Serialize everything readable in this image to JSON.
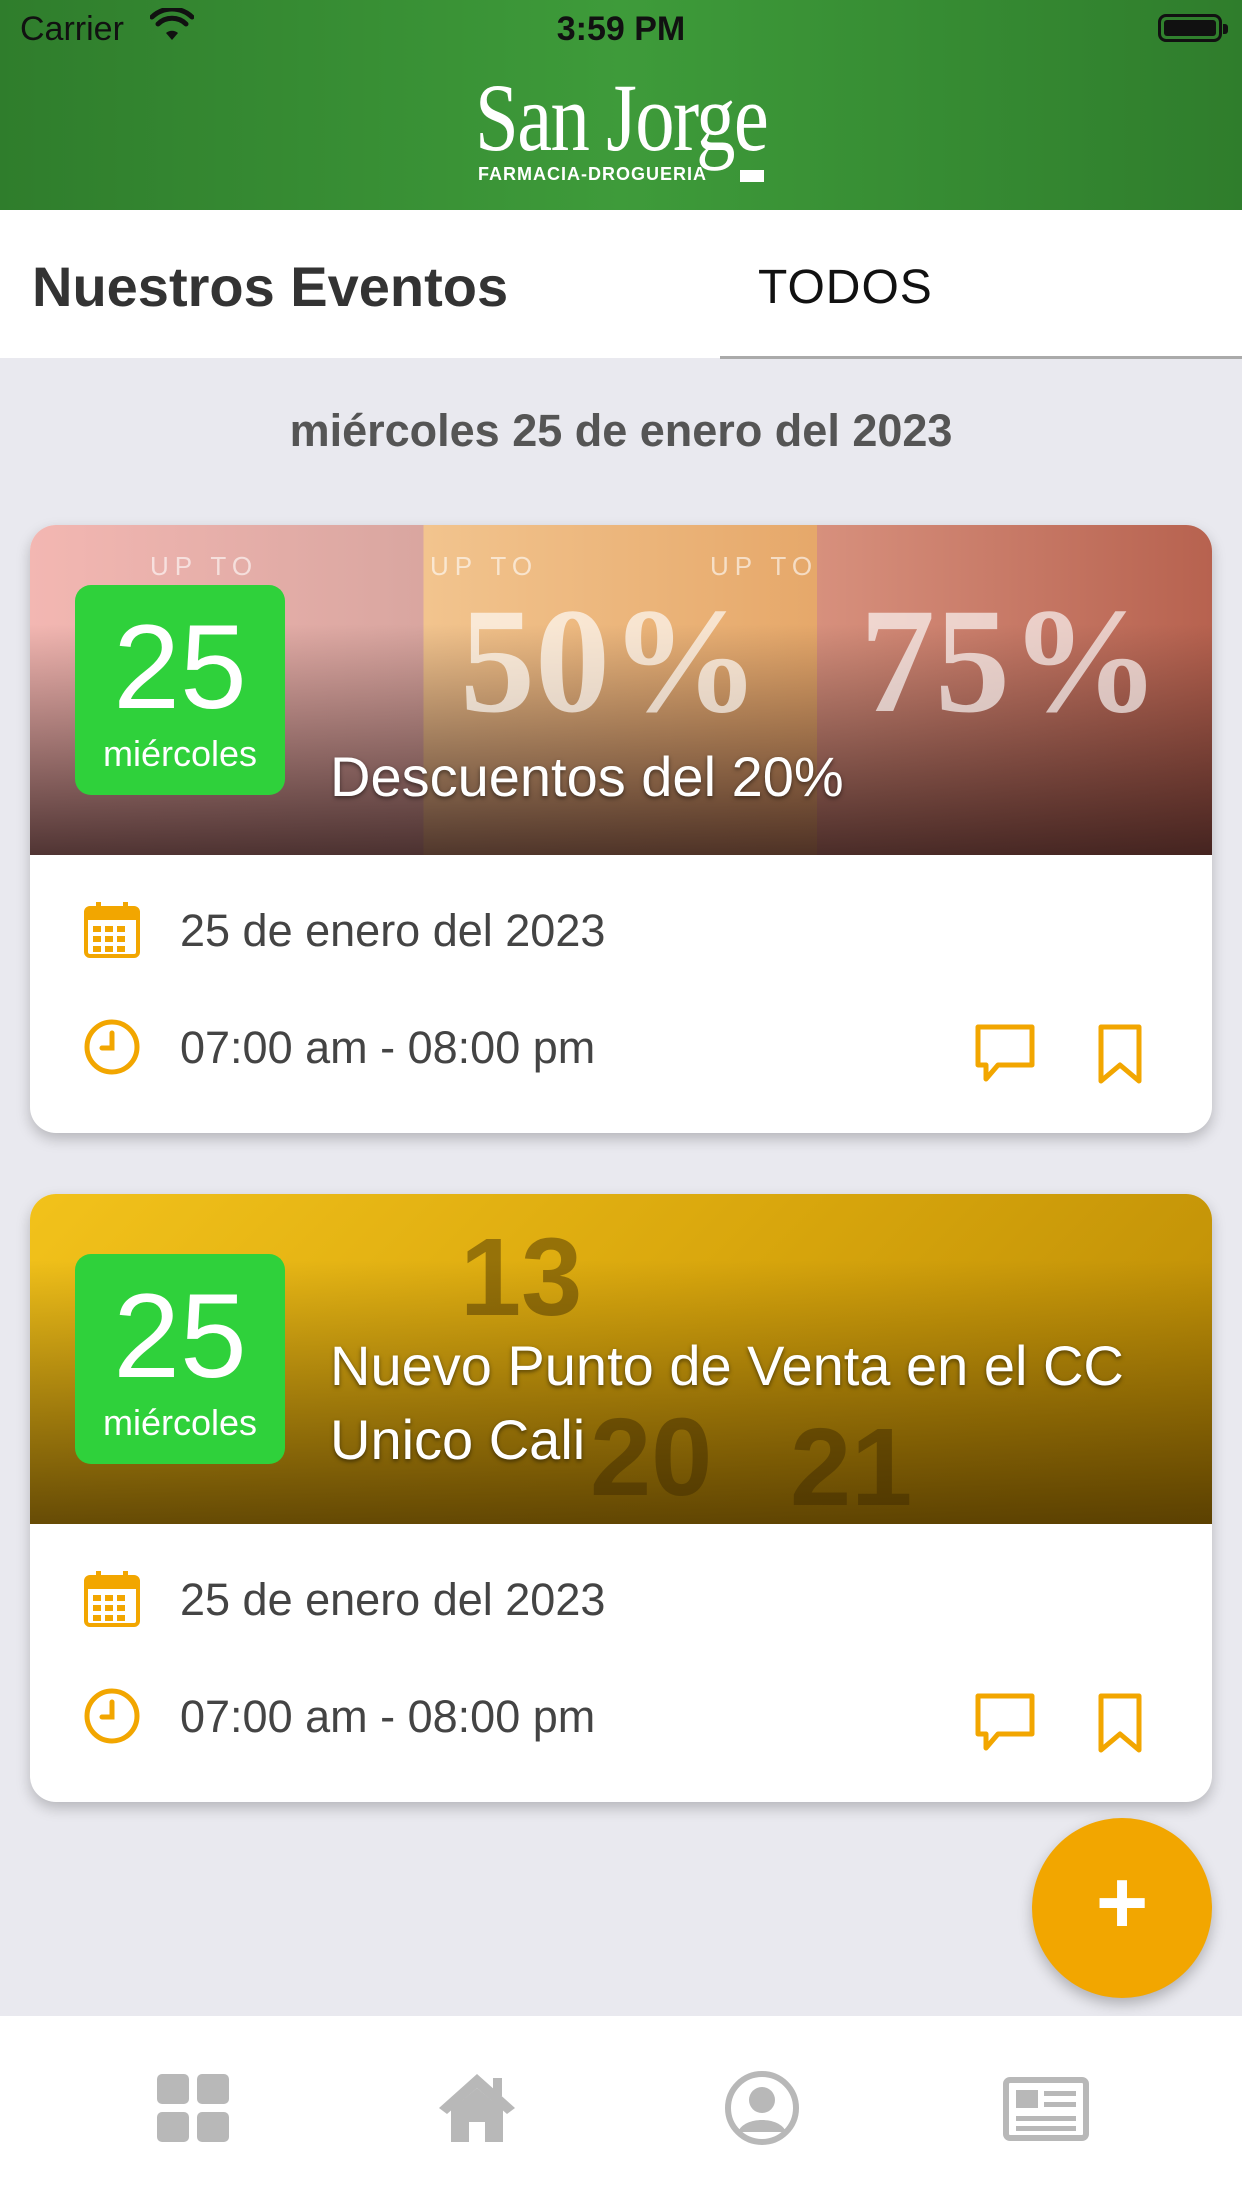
{
  "status_bar": {
    "carrier": "Carrier",
    "time": "3:59 PM"
  },
  "header": {
    "brand": "San Jorge",
    "subtitle": "FARMACIA-DROGUERIA"
  },
  "section": {
    "title": "Nuestros Eventos",
    "tab_label": "TODOS"
  },
  "date_heading": "miércoles 25 de enero del 2023",
  "events": [
    {
      "day": "25",
      "weekday": "miércoles",
      "title": "Descuentos del 20%",
      "date": "25 de enero del 2023",
      "time": "07:00 am - 08:00 pm",
      "banner_text": [
        "UP TO",
        "50%",
        "UP TO",
        "75%"
      ]
    },
    {
      "day": "25",
      "weekday": "miércoles",
      "title": "Nuevo Punto de Venta en el CC Unico Cali",
      "date": "25 de enero del 2023",
      "time": "07:00 am - 08:00 pm"
    }
  ],
  "fab": {
    "label": "+"
  },
  "colors": {
    "header_green": "#3e9b3a",
    "accent_orange": "#f2a600",
    "badge_green": "#2fd13b"
  },
  "icons": {
    "card_rows": [
      "calendar-icon",
      "clock-icon"
    ],
    "card_actions": [
      "comment-icon",
      "bookmark-icon"
    ],
    "bottom_nav": [
      "grid-icon",
      "home-icon",
      "user-icon",
      "newspaper-icon"
    ]
  }
}
